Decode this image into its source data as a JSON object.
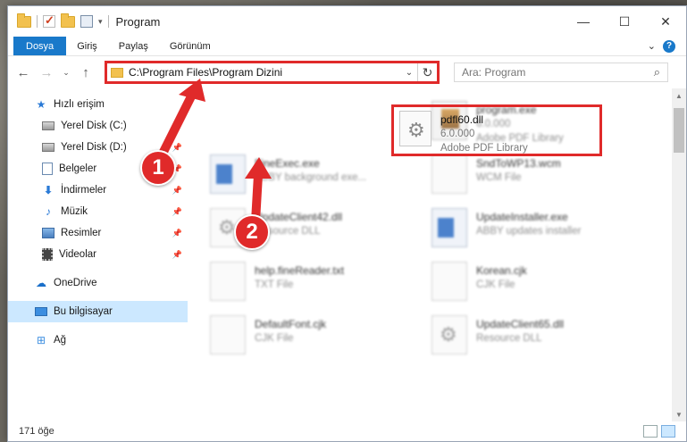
{
  "window": {
    "title": "Program"
  },
  "title_controls": {
    "minimize": "—",
    "maximize": "☐",
    "close": "✕"
  },
  "ribbon": {
    "tabs": [
      "Dosya",
      "Giriş",
      "Paylaş",
      "Görünüm"
    ],
    "expand": "⌄",
    "help": "?"
  },
  "nav": {
    "back": "←",
    "forward": "→",
    "recent": "⌄",
    "up": "↑"
  },
  "address": {
    "path": "C:\\Program Files\\Program Dizini",
    "dropdown": "⌄",
    "refresh": "↻"
  },
  "search": {
    "placeholder": "Ara: Program",
    "icon": "search-icon"
  },
  "sidebar": {
    "items": [
      {
        "label": "Hızlı erişim",
        "icon": "star-icon",
        "pinned": false
      },
      {
        "label": "Yerel Disk (C:)",
        "icon": "drive-icon",
        "pinned": true
      },
      {
        "label": "Yerel Disk (D:)",
        "icon": "drive-icon",
        "pinned": true
      },
      {
        "label": "Belgeler",
        "icon": "documents-icon",
        "pinned": true
      },
      {
        "label": "İndirmeler",
        "icon": "downloads-icon",
        "pinned": true
      },
      {
        "label": "Müzik",
        "icon": "music-icon",
        "pinned": true
      },
      {
        "label": "Resimler",
        "icon": "pictures-icon",
        "pinned": true
      },
      {
        "label": "Videolar",
        "icon": "videos-icon",
        "pinned": true
      },
      {
        "label": "OneDrive",
        "icon": "cloud-icon",
        "pinned": false
      },
      {
        "label": "Bu bilgisayar",
        "icon": "computer-icon",
        "pinned": false
      },
      {
        "label": "Ağ",
        "icon": "network-icon",
        "pinned": false
      }
    ]
  },
  "highlighted_file": {
    "name": "pdfl60.dll",
    "version": "6.0.000",
    "description": "Adobe PDF Library"
  },
  "files": [
    {
      "name": "program.exe",
      "sub1": "6.0.000",
      "sub2": "Adobe PDF Library",
      "icon": "setup-icon"
    },
    {
      "name": "FineExec.exe",
      "sub1": "ABBY background exe...",
      "icon": "exe-icon"
    },
    {
      "name": "SndToWP13.wcm",
      "sub1": "WCM File",
      "icon": "file-icon"
    },
    {
      "name": "UpdateClient42.dll",
      "sub1": "Resource DLL",
      "icon": "dll-icon"
    },
    {
      "name": "UpdateInstaller.exe",
      "sub1": "ABBY updates installer",
      "icon": "exe-icon"
    },
    {
      "name": "help.fineReader.txt",
      "sub1": "TXT File",
      "icon": "file-icon"
    },
    {
      "name": "Korean.cjk",
      "sub1": "CJK File",
      "icon": "file-icon"
    },
    {
      "name": "DefaultFont.cjk",
      "sub1": "CJK File",
      "icon": "file-icon"
    },
    {
      "name": "UpdateClient65.dll",
      "sub1": "Resource DLL",
      "icon": "dll-icon"
    }
  ],
  "status": {
    "count": "171 öğe"
  },
  "annotations": {
    "badge1": "1",
    "badge2": "2",
    "color": "#e02a2a"
  }
}
